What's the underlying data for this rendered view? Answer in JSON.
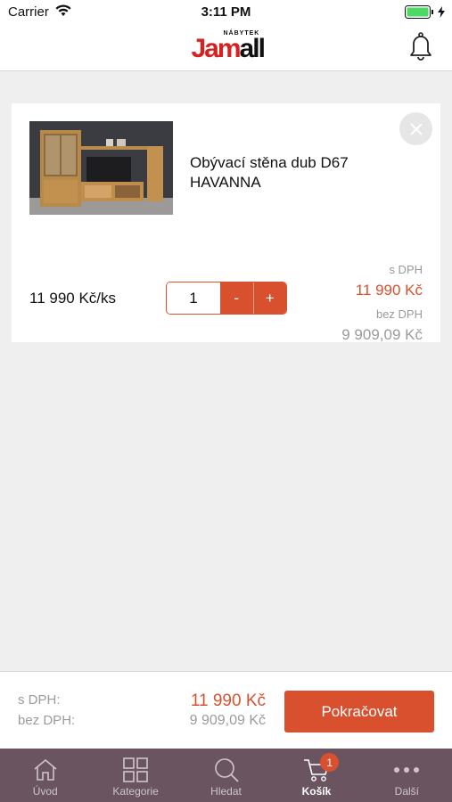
{
  "status_bar": {
    "carrier": "Carrier",
    "time": "3:11 PM"
  },
  "header": {
    "logo_sup": "NÁBYTEK",
    "logo_jam": "Jam",
    "logo_all": "all"
  },
  "cart_item": {
    "name": "Obývací stěna dub D67 HAVANNA",
    "unit_price": "11 990 Kč/ks",
    "quantity": "1",
    "minus_label": "-",
    "plus_label": "+",
    "with_vat_label": "s DPH",
    "with_vat_price": "11 990 Kč",
    "without_vat_label": "bez DPH",
    "without_vat_price": "9 909,09 Kč"
  },
  "summary": {
    "with_vat_label": "s DPH:",
    "with_vat_price": "11 990 Kč",
    "without_vat_label": "bez DPH:",
    "without_vat_price": "9 909,09 Kč",
    "continue_label": "Pokračovat"
  },
  "tabs": [
    {
      "label": "Úvod",
      "icon": "home-icon"
    },
    {
      "label": "Kategorie",
      "icon": "grid-icon"
    },
    {
      "label": "Hledat",
      "icon": "search-icon"
    },
    {
      "label": "Košík",
      "icon": "cart-icon",
      "badge": "1",
      "active": true
    },
    {
      "label": "Další",
      "icon": "more-icon"
    }
  ],
  "colors": {
    "accent": "#d9502f",
    "tabbar": "#6a545f",
    "logo_red": "#d6211e"
  }
}
